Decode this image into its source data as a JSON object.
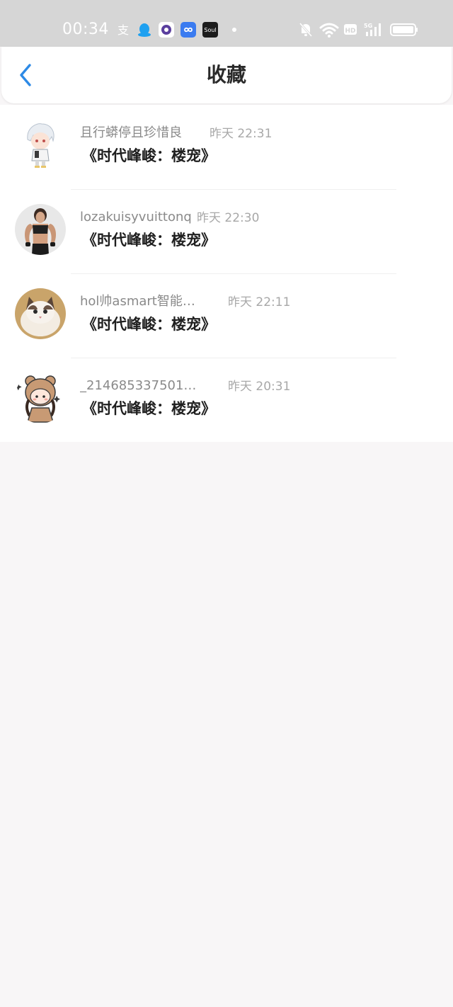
{
  "status_bar": {
    "time": "00:34",
    "hd_label": "HD",
    "network_label": "5G",
    "app_icons": [
      "alipay-icon",
      "qq-icon",
      "browser-icon",
      "infinity-app-icon",
      "soul-app-icon"
    ],
    "soul_label": "Soul"
  },
  "nav": {
    "title": "收藏",
    "back_icon": "chevron-left-icon",
    "accent_color": "#2d8ae6"
  },
  "favorites": [
    {
      "username": "且行蟒停且珍惜良",
      "time": "昨天 22:31",
      "title": "《时代峰峻：楼宠》",
      "avatar": "anime-boy-avatar"
    },
    {
      "username": "lozakuisyvuittonq",
      "time": "昨天 22:30",
      "title": "《时代峰峻：楼宠》",
      "avatar": "fitness-woman-avatar"
    },
    {
      "username": "hol帅asmart智能…",
      "time": "昨天 22:11",
      "title": "《时代峰峻：楼宠》",
      "avatar": "kitten-avatar"
    },
    {
      "username": "_214685337501…",
      "time": "昨天 20:31",
      "title": "《时代峰峻：楼宠》",
      "avatar": "bear-hood-girl-avatar"
    }
  ]
}
